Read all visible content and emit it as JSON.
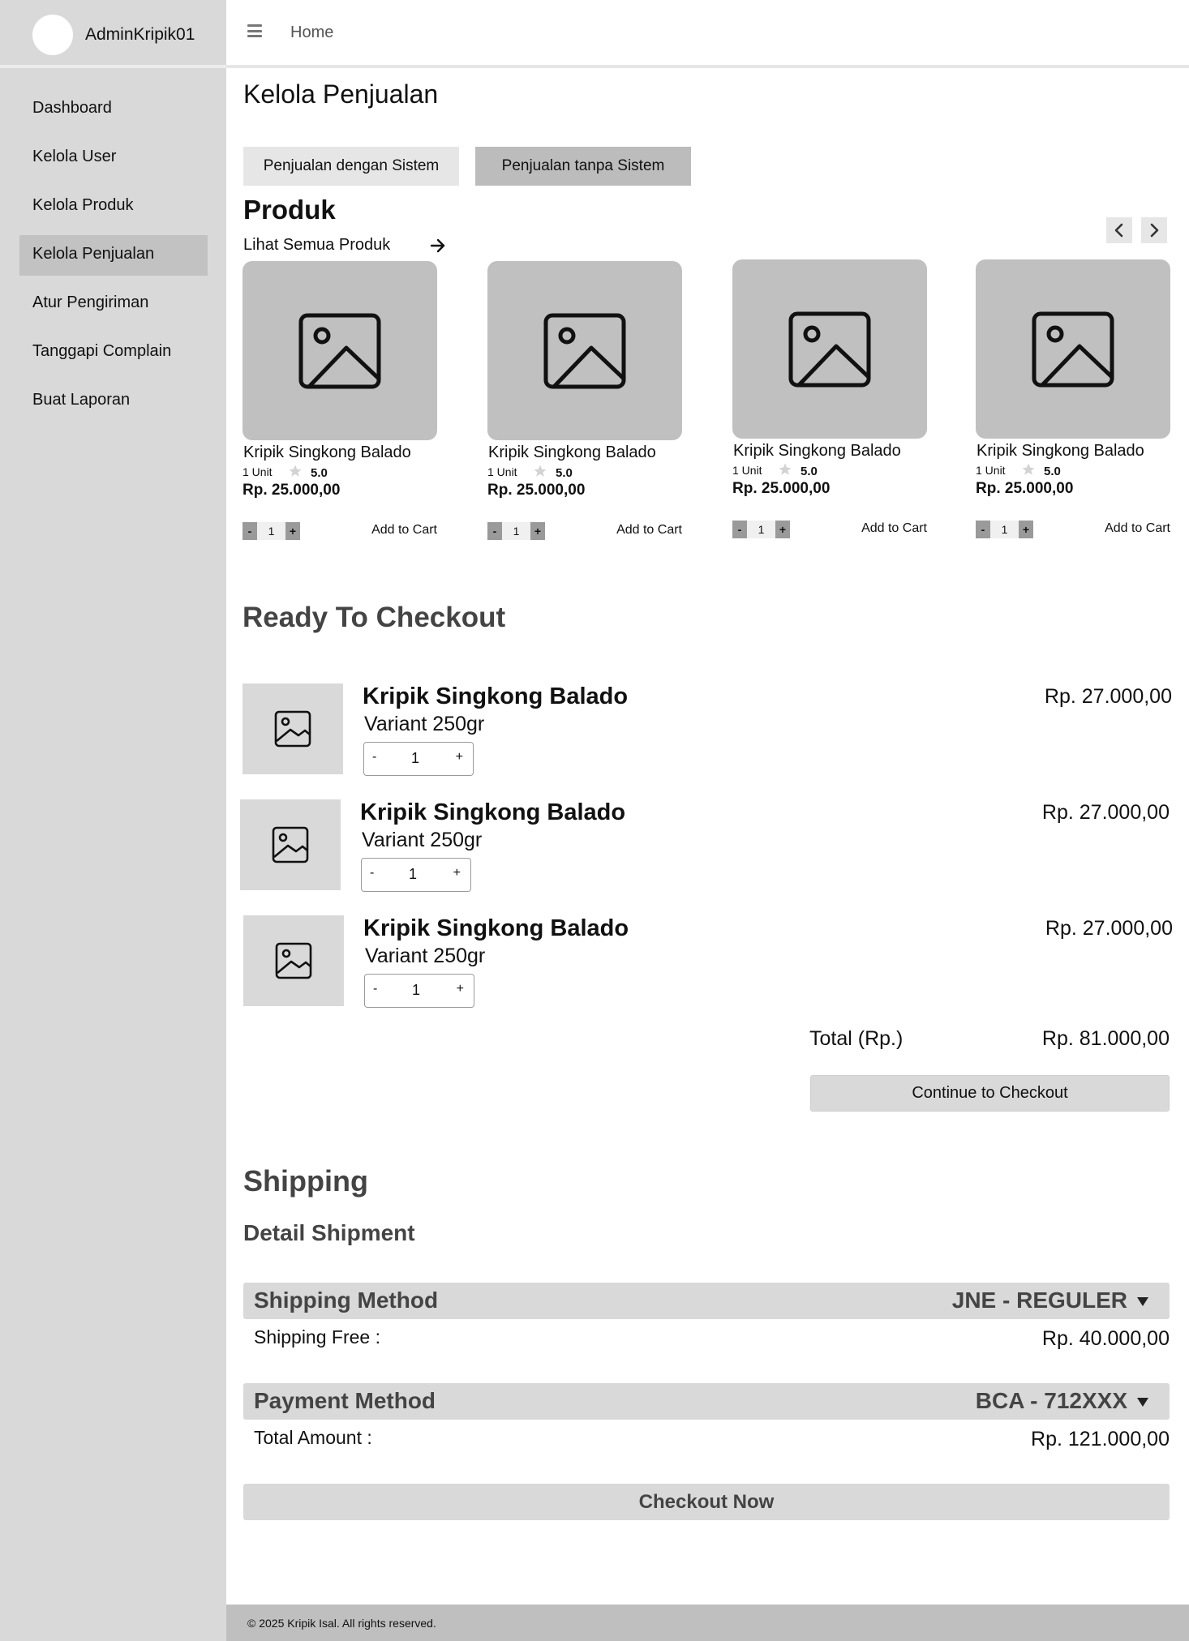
{
  "user": {
    "name": "AdminKripik01"
  },
  "sidebar": {
    "items": [
      {
        "label": "Dashboard",
        "active": false
      },
      {
        "label": "Kelola User",
        "active": false
      },
      {
        "label": "Kelola Produk",
        "active": false
      },
      {
        "label": "Kelola Penjualan",
        "active": true
      },
      {
        "label": "Atur Pengiriman",
        "active": false
      },
      {
        "label": "Tanggapi Complain",
        "active": false
      },
      {
        "label": "Buat Laporan",
        "active": false
      }
    ]
  },
  "header": {
    "breadcrumb": "Home",
    "menu_icon": "hamburger-icon"
  },
  "main": {
    "title": "Kelola Penjualan",
    "tabs": [
      {
        "label": "Penjualan dengan Sistem",
        "active": false
      },
      {
        "label": "Penjualan tanpa Sistem",
        "active": true
      }
    ]
  },
  "products": {
    "heading": "Produk",
    "see_all": "Lihat Semua Produk",
    "items": [
      {
        "name": "Kripik  Singkong Balado",
        "unit": "1 Unit",
        "rating": "5.0",
        "price": "Rp. 25.000,00",
        "qty": "1",
        "minus": "-",
        "plus": "+",
        "add_label": "Add to Cart"
      },
      {
        "name": "Kripik  Singkong Balado",
        "unit": "1 Unit",
        "rating": "5.0",
        "price": "Rp. 25.000,00",
        "qty": "1",
        "minus": "-",
        "plus": "+",
        "add_label": "Add to Cart"
      },
      {
        "name": "Kripik  Singkong Balado",
        "unit": "1 Unit",
        "rating": "5.0",
        "price": "Rp. 25.000,00",
        "qty": "1",
        "minus": "-",
        "plus": "+",
        "add_label": "Add to Cart"
      },
      {
        "name": "Kripik  Singkong Balado",
        "unit": "1 Unit",
        "rating": "5.0",
        "price": "Rp. 25.000,00",
        "qty": "1",
        "minus": "-",
        "plus": "+",
        "add_label": "Add to Cart"
      }
    ]
  },
  "checkout": {
    "heading": "Ready To Checkout",
    "items": [
      {
        "name": "Kripik Singkong Balado",
        "variant": "Variant 250gr",
        "qty": "1",
        "minus": "-",
        "plus": "+",
        "price": "Rp. 27.000,00"
      },
      {
        "name": "Kripik Singkong Balado",
        "variant": "Variant 250gr",
        "qty": "1",
        "minus": "-",
        "plus": "+",
        "price": "Rp. 27.000,00"
      },
      {
        "name": "Kripik Singkong Balado",
        "variant": "Variant 250gr",
        "qty": "1",
        "minus": "-",
        "plus": "+",
        "price": "Rp. 27.000,00"
      }
    ],
    "total_label": "Total (Rp.)",
    "total_value": "Rp. 81.000,00",
    "continue_label": "Continue to Checkout"
  },
  "shipping": {
    "heading": "Shipping",
    "subheading": "Detail Shipment",
    "method_label": "Shipping Method",
    "method_value": "JNE - REGULER",
    "fee_label": "Shipping Free :",
    "fee_value": "Rp. 40.000,00",
    "payment_label": "Payment Method",
    "payment_value": "BCA - 712XXX",
    "amount_label": "Total Amount :",
    "amount_value": "Rp. 121.000,00",
    "checkout_label": "Checkout Now"
  },
  "footer": {
    "text": "© 2025 Kripik Isal. All rights reserved."
  },
  "colors": {
    "sidebar_bg": "#d9d9d9",
    "active_item": "#c2c2c2",
    "placeholder": "#c0c0c0",
    "footer_bg": "#bfbfbf"
  }
}
